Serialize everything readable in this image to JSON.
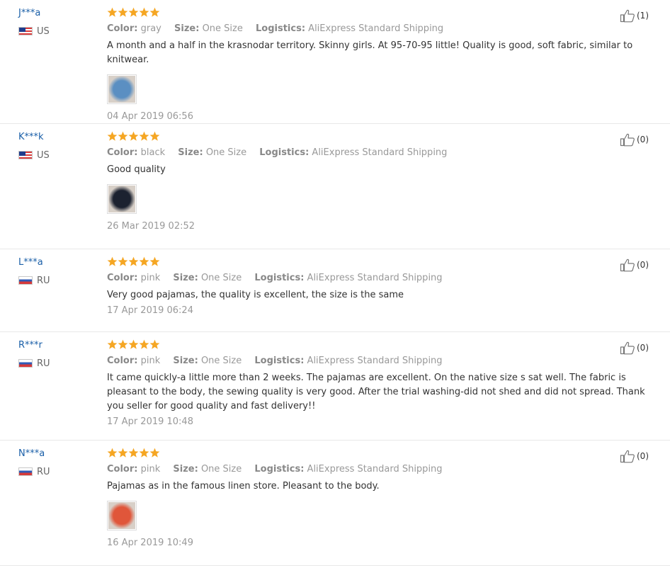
{
  "colors": {
    "star": "#f5a623",
    "username": "#1a5fa8"
  },
  "labels": {
    "color": "Color:",
    "size": "Size:",
    "logistics": "Logistics:"
  },
  "reviews": [
    {
      "user": "J***a",
      "country": "US",
      "flag": "us-flag-icon",
      "stars": 5,
      "color": "gray",
      "size": "One Size",
      "logistics": "AliExpress Standard Shipping",
      "text": "A month and a half in the krasnodar territory. Skinny girls. At 95-70-95 little! Quality is good, soft fabric, similar to knitwear.",
      "has_photo": true,
      "photo_color": "#5b8fc2",
      "date": "04 Apr 2019 06:56",
      "helpful": "(1)"
    },
    {
      "user": "K***k",
      "country": "US",
      "flag": "us-flag-icon",
      "stars": 5,
      "color": "black",
      "size": "One Size",
      "logistics": "AliExpress Standard Shipping",
      "text": "Good quality",
      "has_photo": true,
      "photo_color": "#1c2230",
      "date": "26 Mar 2019 02:52",
      "helpful": "(0)"
    },
    {
      "user": "L***a",
      "country": "RU",
      "flag": "ru-flag-icon",
      "stars": 5,
      "color": "pink",
      "size": "One Size",
      "logistics": "AliExpress Standard Shipping",
      "text": "Very good pajamas, the quality is excellent, the size is the same",
      "has_photo": false,
      "date": "17 Apr 2019 06:24",
      "helpful": "(0)"
    },
    {
      "user": "R***r",
      "country": "RU",
      "flag": "ru-flag-icon",
      "stars": 5,
      "color": "pink",
      "size": "One Size",
      "logistics": "AliExpress Standard Shipping",
      "text": "It came quickly-a little more than 2 weeks. The pajamas are excellent. On the native size s sat well. The fabric is pleasant to the body, the sewing quality is very good. After the trial washing-did not shed and did not spread. Thank you seller for good quality and fast delivery!!",
      "has_photo": false,
      "date": "17 Apr 2019 10:48",
      "helpful": "(0)"
    },
    {
      "user": "N***a",
      "country": "RU",
      "flag": "ru-flag-icon",
      "stars": 5,
      "color": "pink",
      "size": "One Size",
      "logistics": "AliExpress Standard Shipping",
      "text": "Pajamas as in the famous linen store. Pleasant to the body.",
      "has_photo": true,
      "photo_color": "#e0563a",
      "date": "16 Apr 2019 10:49",
      "helpful": "(0)"
    }
  ]
}
